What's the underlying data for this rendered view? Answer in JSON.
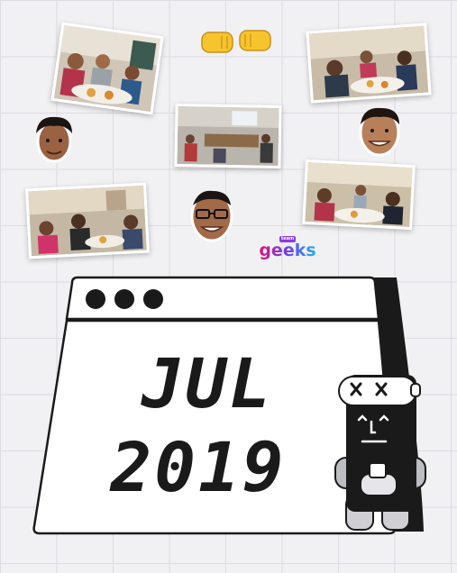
{
  "calendar": {
    "month": "JUL",
    "year": "2019"
  },
  "logo": {
    "tag": "team",
    "word": "geeks"
  },
  "icons": [
    "fist-bump-icon",
    "window-dots-icon",
    "robot-mascot-icon"
  ],
  "colors": {
    "ink": "#1a1a1a",
    "paper": "#ffffff",
    "grid": "#dcdce2",
    "emoji": "#f6c42c"
  }
}
